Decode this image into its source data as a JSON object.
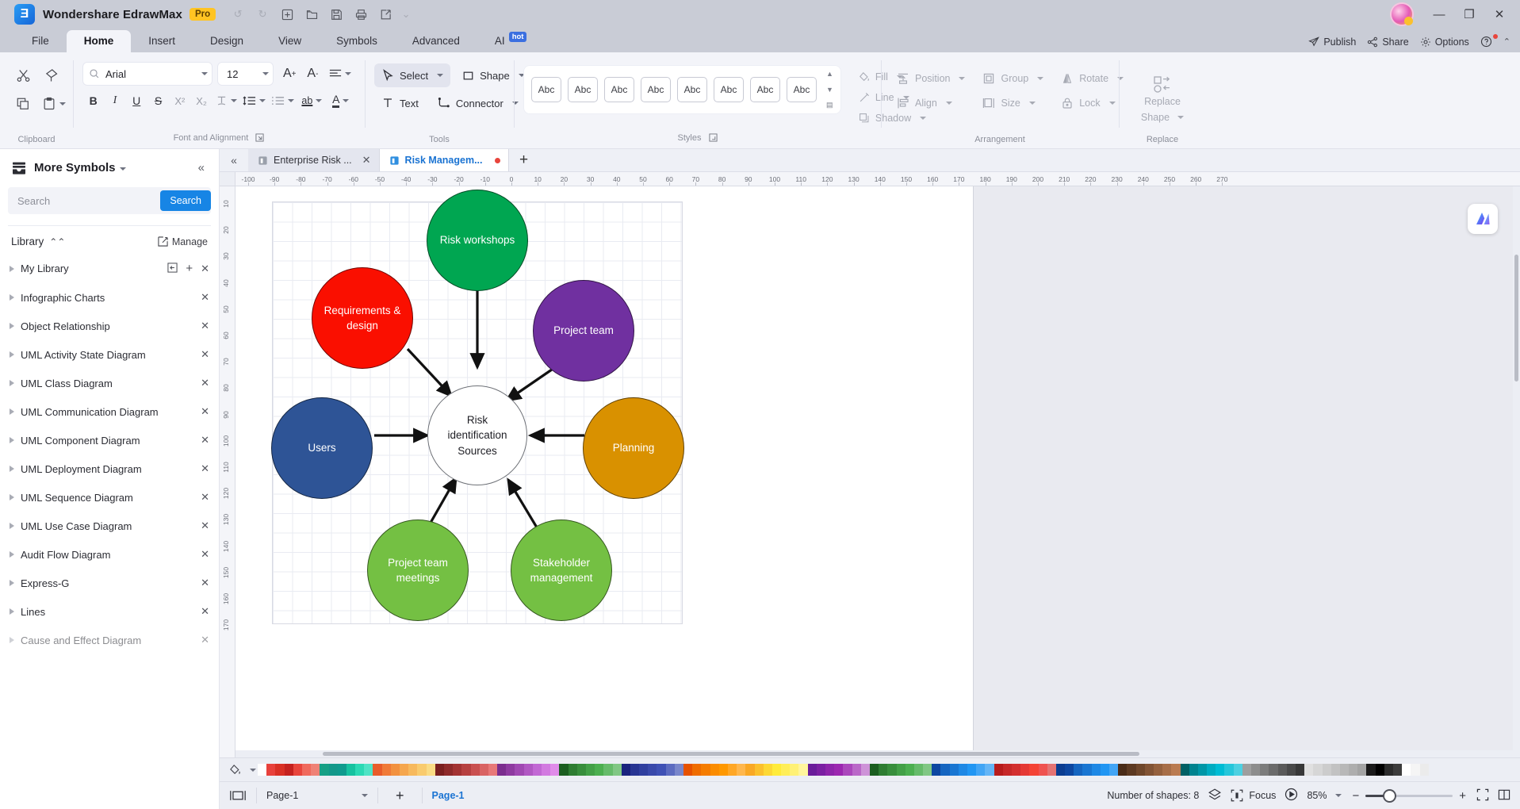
{
  "titlebar": {
    "app_name": "Wondershare EdrawMax",
    "badge": "Pro",
    "logo_glyph": "Ǝ",
    "quick_access": [
      {
        "name": "undo-button",
        "glyph": "↺"
      },
      {
        "name": "redo-button",
        "glyph": "↻"
      },
      {
        "name": "new-button",
        "glyph": "＋"
      },
      {
        "name": "open-button",
        "glyph": "🗀"
      },
      {
        "name": "save-button",
        "glyph": "🖫"
      },
      {
        "name": "print-button",
        "glyph": "🖨"
      },
      {
        "name": "export-button",
        "glyph": "🗗"
      },
      {
        "name": "customize-qat-button",
        "glyph": "⌄"
      }
    ],
    "window_buttons": {
      "minimize": "—",
      "maximize": "❐",
      "close": "✕"
    }
  },
  "menubar": {
    "items": [
      "File",
      "Home",
      "Insert",
      "Design",
      "View",
      "Symbols",
      "Advanced",
      "AI"
    ],
    "active": "Home",
    "ai_badge": "hot",
    "right_items": [
      {
        "label": "Publish",
        "icon": "publish-icon"
      },
      {
        "label": "Share",
        "icon": "share-icon"
      },
      {
        "label": "Options",
        "icon": "gear-icon"
      }
    ],
    "help_glyph": "?",
    "collapse_glyph": "⌃"
  },
  "ribbon": {
    "groups": [
      {
        "label": "Clipboard",
        "dialog_launcher": false
      },
      {
        "label": "Font and Alignment",
        "dialog_launcher": true
      },
      {
        "label": "Tools",
        "dialog_launcher": false
      },
      {
        "label": "Styles",
        "dialog_launcher": true
      },
      {
        "label": "Arrangement",
        "dialog_launcher": false
      },
      {
        "label": "Replace",
        "dialog_launcher": false
      }
    ],
    "clipboard": {
      "cut": "✂",
      "format_painter": "🖌",
      "copy": "⧉",
      "paste": "📋"
    },
    "font": {
      "family_value": "Arial",
      "family_placeholder": "Arial",
      "size_value": "12",
      "increase_label": "A",
      "decrease_label": "A",
      "buttons": [
        "B",
        "I",
        "U",
        "S",
        "X²",
        "X₂",
        "T",
        "↕≡",
        "≡",
        "ab",
        "A"
      ]
    },
    "tools": {
      "select_label": "Select",
      "shape_label": "Shape",
      "text_label": "Text",
      "connector_label": "Connector"
    },
    "styles": {
      "chips": [
        "Abc",
        "Abc",
        "Abc",
        "Abc",
        "Abc",
        "Abc",
        "Abc",
        "Abc"
      ],
      "fill_label": "Fill",
      "line_label": "Line",
      "shadow_label": "Shadow"
    },
    "arrangement": {
      "position_label": "Position",
      "align_label": "Align",
      "group_label": "Group",
      "size_label": "Size",
      "rotate_label": "Rotate",
      "lock_label": "Lock"
    },
    "replace": {
      "label_line1": "Replace",
      "label_line2": "Shape"
    }
  },
  "sidepanel": {
    "title": "More Symbols",
    "search_placeholder": "Search",
    "search_value": "",
    "search_button": "Search",
    "library_label": "Library",
    "manage_label": "Manage",
    "items": [
      {
        "label": "My Library",
        "has_import": true,
        "has_add": true,
        "has_close": true
      },
      {
        "label": "Infographic Charts",
        "has_close": true
      },
      {
        "label": "Object Relationship",
        "has_close": true
      },
      {
        "label": "UML Activity State Diagram",
        "has_close": true
      },
      {
        "label": "UML Class Diagram",
        "has_close": true
      },
      {
        "label": "UML Communication Diagram",
        "has_close": true
      },
      {
        "label": "UML Component Diagram",
        "has_close": true
      },
      {
        "label": "UML Deployment Diagram",
        "has_close": true
      },
      {
        "label": "UML Sequence Diagram",
        "has_close": true
      },
      {
        "label": "UML Use Case Diagram",
        "has_close": true
      },
      {
        "label": "Audit Flow Diagram",
        "has_close": true
      },
      {
        "label": "Express-G",
        "has_close": true
      },
      {
        "label": "Lines",
        "has_close": true
      },
      {
        "label": "Cause and Effect Diagram",
        "has_close": true
      }
    ]
  },
  "doc_tabs": {
    "collapse_glyph": "«",
    "tabs": [
      {
        "label": "Enterprise Risk ...",
        "active": false,
        "modified": false
      },
      {
        "label": "Risk Managem...",
        "active": true,
        "modified": true
      }
    ],
    "add_glyph": "+"
  },
  "rulers": {
    "h_ticks": [
      "-100",
      "-90",
      "-80",
      "-70",
      "-60",
      "-50",
      "-40",
      "-30",
      "-20",
      "-10",
      "0",
      "10",
      "20",
      "30",
      "40",
      "50",
      "60",
      "70",
      "80",
      "90",
      "100",
      "110",
      "120",
      "130",
      "140",
      "150",
      "160",
      "170",
      "180",
      "190",
      "200",
      "210",
      "220",
      "230",
      "240",
      "250",
      "260",
      "270"
    ],
    "v_ticks": [
      "10",
      "20",
      "30",
      "40",
      "50",
      "60",
      "70",
      "80",
      "90",
      "100",
      "110",
      "120",
      "130",
      "140",
      "150",
      "160",
      "170"
    ]
  },
  "diagram": {
    "title": "Risk identification Sources",
    "center": {
      "label": "Risk identification Sources",
      "color": "#ffffff"
    },
    "nodes": [
      {
        "label": "Risk workshops",
        "color": "#00a651"
      },
      {
        "label": "Requirements & design",
        "color": "#fa0f00"
      },
      {
        "label": "Project team",
        "color": "#7030a0"
      },
      {
        "label": "Users",
        "color": "#2e5496"
      },
      {
        "label": "Planning",
        "color": "#d99100"
      },
      {
        "label": "Project team meetings",
        "color": "#74c043"
      },
      {
        "label": "Stakeholder management",
        "color": "#74c043"
      }
    ],
    "ai_badge": "ai-assistant-icon"
  },
  "statusbar": {
    "page_selector_value": "Page-1",
    "add_page_glyph": "+",
    "active_page": "Page-1",
    "shapes_label": "Number of shapes: 8",
    "focus_label": "Focus",
    "zoom_value": "85%",
    "zoom_out_glyph": "−",
    "zoom_in_glyph": "+",
    "fit_page_glyph": "⛶",
    "fit_width_glyph": "⇤⇥"
  },
  "palette": {
    "colors": [
      "#ffffff",
      "#e8413b",
      "#d93025",
      "#c5221f",
      "#e8453c",
      "#f06a5d",
      "#ef8276",
      "#16a085",
      "#13988a",
      "#0f9b8e",
      "#16c2a0",
      "#2bd9b4",
      "#4fe3c5",
      "#e85c2a",
      "#f07a38",
      "#f2913f",
      "#f5a64d",
      "#f7b95d",
      "#f9cb6e",
      "#fadc85",
      "#7a1f1f",
      "#8e2a2a",
      "#a33333",
      "#b64040",
      "#c95050",
      "#d96363",
      "#e87878",
      "#7b2d8e",
      "#8e3aa0",
      "#a048b2",
      "#b158c3",
      "#c268d4",
      "#d27ae0",
      "#e08ce9",
      "#1b5e20",
      "#2e7d32",
      "#388e3c",
      "#43a047",
      "#4caf50",
      "#66bb6a",
      "#81c784",
      "#1a237e",
      "#283593",
      "#303f9f",
      "#3949ab",
      "#3f51b5",
      "#5c6bc0",
      "#7986cb",
      "#e65100",
      "#ef6c00",
      "#f57c00",
      "#fb8c00",
      "#ff9800",
      "#ffa726",
      "#ffb74d",
      "#f9a825",
      "#fbc02d",
      "#fdd835",
      "#ffeb3b",
      "#ffee58",
      "#fff176",
      "#fff59d",
      "#6a1b9a",
      "#7b1fa2",
      "#8e24aa",
      "#9c27b0",
      "#ab47bc",
      "#ba68c8",
      "#ce93d8",
      "#1b5e20",
      "#2e7d32",
      "#388e3c",
      "#43a047",
      "#4caf50",
      "#66bb6a",
      "#81c784",
      "#0d47a1",
      "#1565c0",
      "#1976d2",
      "#1e88e5",
      "#2196f3",
      "#42a5f5",
      "#64b5f6",
      "#b71c1c",
      "#c62828",
      "#d32f2f",
      "#e53935",
      "#f44336",
      "#ef5350",
      "#e57373",
      "#0b3d91",
      "#0d47a1",
      "#1565c0",
      "#1976d2",
      "#1e88e5",
      "#2196f3",
      "#42a5f5",
      "#4a2c18",
      "#5d3a22",
      "#6f472b",
      "#825435",
      "#95613e",
      "#a76e48",
      "#ba7b51",
      "#006064",
      "#00838f",
      "#0097a7",
      "#00acc1",
      "#00bcd4",
      "#26c6da",
      "#4dd0e1",
      "#9e9e9e",
      "#8d8d8d",
      "#7c7c7c",
      "#6b6b6b",
      "#5a5a5a",
      "#494949",
      "#383838",
      "#e0e0e0",
      "#d6d6d6",
      "#cccccc",
      "#c2c2c2",
      "#b8b8b8",
      "#aeaeae",
      "#a4a4a4",
      "#1a1a1a",
      "#000000",
      "#2b2b2b",
      "#3c3c3c",
      "#ffffff",
      "#f5f5f5",
      "#ebebeb"
    ]
  }
}
